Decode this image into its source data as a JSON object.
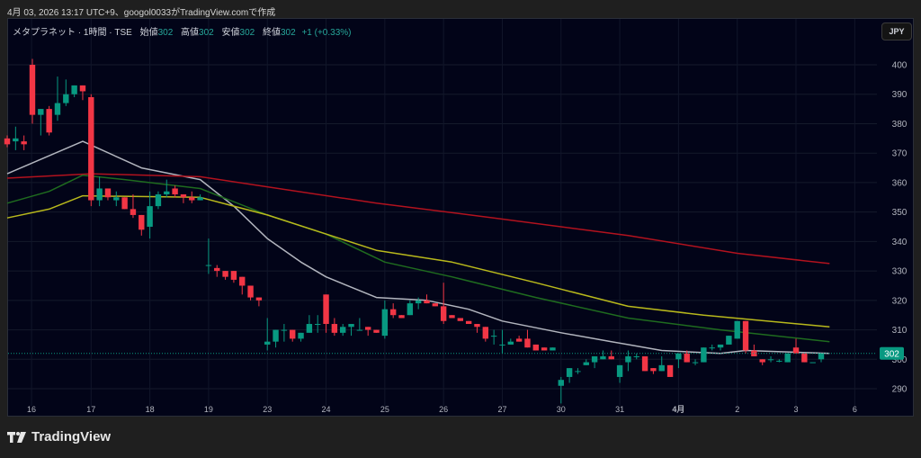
{
  "caption": "4月 03, 2026 13:17 UTC+9、googol0033がTradingView.comで作成",
  "legend": {
    "symbol": "メタプラネット · 1時間 · TSE",
    "open_label": "始値",
    "open": "302",
    "high_label": "高値",
    "high": "302",
    "low_label": "安値",
    "low": "302",
    "close_label": "終値",
    "close": "302",
    "change": "+1 (+0.33%)"
  },
  "currency_button": "JPY",
  "last_price_label": "302",
  "footer_brand": "TradingView",
  "colors": {
    "up": "#089981",
    "down": "#f23645",
    "ma_white": "#b2b5be",
    "ma_red": "#b2121e",
    "ma_green": "#1b5e20",
    "ma_yellow": "#b5b51a",
    "last": "#089981"
  },
  "chart_data": {
    "type": "candlestick",
    "ylim": [
      285,
      410
    ],
    "y_ticks": [
      290,
      300,
      310,
      320,
      330,
      340,
      350,
      360,
      370,
      380,
      390,
      400
    ],
    "x_ticks": [
      {
        "label": "16",
        "index": 2.9
      },
      {
        "label": "17",
        "index": 10
      },
      {
        "label": "18",
        "index": 17
      },
      {
        "label": "19",
        "index": 24
      },
      {
        "label": "23",
        "index": 31
      },
      {
        "label": "24",
        "index": 38
      },
      {
        "label": "25",
        "index": 45
      },
      {
        "label": "26",
        "index": 52
      },
      {
        "label": "27",
        "index": 59
      },
      {
        "label": "30",
        "index": 66
      },
      {
        "label": "31",
        "index": 73
      },
      {
        "label": "4月",
        "index": 80,
        "bold": true
      },
      {
        "label": "2",
        "index": 87
      },
      {
        "label": "3",
        "index": 94
      },
      {
        "label": "6",
        "index": 101
      }
    ],
    "last_price": 302,
    "ohlc": [
      [
        375,
        376,
        372,
        373
      ],
      [
        374,
        379,
        371,
        375
      ],
      [
        374,
        376,
        371,
        373
      ],
      [
        400,
        402,
        380,
        383
      ],
      [
        383,
        385,
        376,
        385
      ],
      [
        385,
        386,
        376,
        377
      ],
      [
        383,
        396,
        381,
        387
      ],
      [
        387,
        395,
        386,
        390
      ],
      [
        390,
        393,
        389,
        393
      ],
      [
        393,
        393,
        388,
        391
      ],
      [
        389,
        390,
        352,
        354
      ],
      [
        354,
        362,
        352,
        358
      ],
      [
        358,
        358,
        354,
        355
      ],
      [
        354,
        357,
        352,
        355
      ],
      [
        355,
        355,
        351,
        351
      ],
      [
        351,
        356,
        348,
        349
      ],
      [
        349,
        349,
        342,
        344
      ],
      [
        345,
        357,
        341,
        352
      ],
      [
        352,
        357,
        351,
        356
      ],
      [
        356,
        361,
        355,
        357
      ],
      [
        358,
        359,
        355,
        356
      ],
      [
        356,
        356,
        353,
        355
      ],
      [
        355,
        357,
        353,
        354
      ],
      [
        354,
        356,
        354,
        355
      ],
      [
        332,
        341,
        329,
        332
      ],
      [
        331,
        332,
        328,
        330
      ],
      [
        330,
        330,
        327,
        328
      ],
      [
        330,
        330,
        326,
        327
      ],
      [
        328,
        328,
        322,
        325
      ],
      [
        325,
        325,
        320,
        321
      ],
      [
        321,
        321,
        318,
        320
      ],
      [
        305,
        314,
        303,
        306
      ],
      [
        306,
        310,
        304,
        310
      ],
      [
        310,
        312,
        306,
        310
      ],
      [
        310,
        310,
        306,
        307
      ],
      [
        307,
        309,
        306,
        309
      ],
      [
        309,
        315,
        309,
        312
      ],
      [
        312,
        315,
        309,
        312
      ],
      [
        322,
        322,
        309,
        312
      ],
      [
        312,
        314,
        308,
        309
      ],
      [
        309,
        312,
        308,
        311
      ],
      [
        311,
        312,
        308,
        312
      ],
      [
        310,
        314,
        310,
        310
      ],
      [
        311,
        311,
        308,
        310
      ],
      [
        310,
        310,
        309,
        309
      ],
      [
        308,
        320,
        307,
        317
      ],
      [
        317,
        319,
        314,
        315
      ],
      [
        315,
        315,
        314,
        314
      ],
      [
        315,
        320,
        315,
        319
      ],
      [
        319,
        321,
        317,
        320
      ],
      [
        320,
        322,
        319,
        319
      ],
      [
        319,
        319,
        318,
        318
      ],
      [
        318,
        326,
        312,
        313
      ],
      [
        315,
        315,
        314,
        314
      ],
      [
        314,
        314,
        313,
        313
      ],
      [
        313,
        313,
        312,
        312
      ],
      [
        312,
        312,
        309,
        311
      ],
      [
        311,
        311,
        306,
        307
      ],
      [
        308,
        310,
        305,
        308
      ],
      [
        305,
        310,
        302,
        305
      ],
      [
        305,
        307,
        305,
        306
      ],
      [
        307,
        308,
        306,
        306
      ],
      [
        307,
        310,
        304,
        304
      ],
      [
        305,
        305,
        303,
        303
      ],
      [
        304,
        304,
        303,
        303
      ],
      [
        303,
        304,
        303,
        304
      ],
      [
        291,
        294,
        285,
        293
      ],
      [
        294,
        297,
        292,
        297
      ],
      [
        296,
        297,
        295,
        296
      ],
      [
        298,
        300,
        298,
        299
      ],
      [
        299,
        301,
        297,
        301
      ],
      [
        300,
        303,
        300,
        301
      ],
      [
        301,
        303,
        300,
        300
      ],
      [
        294,
        298,
        292,
        298
      ],
      [
        299,
        303,
        296,
        301
      ],
      [
        301,
        302,
        300,
        301
      ],
      [
        301,
        301,
        296,
        296
      ],
      [
        297,
        297,
        295,
        296
      ],
      [
        296,
        301,
        296,
        298
      ],
      [
        298,
        298,
        294,
        294
      ],
      [
        300,
        302,
        297,
        302
      ],
      [
        302,
        303,
        299,
        299
      ],
      [
        299,
        300,
        298,
        299
      ],
      [
        299,
        304,
        299,
        304
      ],
      [
        304,
        305,
        303,
        304
      ],
      [
        304,
        305,
        303,
        305
      ],
      [
        305,
        308,
        305,
        308
      ],
      [
        307,
        313,
        307,
        313
      ],
      [
        313,
        313,
        302,
        303
      ],
      [
        303,
        305,
        302,
        301
      ],
      [
        300,
        300,
        298,
        299
      ],
      [
        300,
        301,
        299,
        300
      ],
      [
        299.5,
        300,
        299,
        299.5
      ],
      [
        299,
        302,
        299,
        302
      ],
      [
        304,
        307,
        302,
        302
      ],
      [
        302,
        302,
        299,
        299
      ],
      [
        299,
        299,
        299,
        299
      ],
      [
        300,
        302,
        299,
        302
      ]
    ],
    "moving_averages": [
      {
        "name": "ma-white",
        "color": "#b2b5be",
        "points": [
          [
            0,
            363
          ],
          [
            9,
            374
          ],
          [
            16,
            365
          ],
          [
            23,
            361
          ],
          [
            27,
            352
          ],
          [
            31,
            341
          ],
          [
            35,
            333
          ],
          [
            38,
            328
          ],
          [
            44,
            321
          ],
          [
            50,
            320
          ],
          [
            55,
            317
          ],
          [
            59,
            313
          ],
          [
            66,
            309
          ],
          [
            72,
            306
          ],
          [
            78,
            303
          ],
          [
            85,
            302
          ],
          [
            88,
            303
          ],
          [
            98,
            302
          ]
        ]
      },
      {
        "name": "ma-red",
        "color": "#b2121e",
        "points": [
          [
            0,
            361.5
          ],
          [
            10,
            363
          ],
          [
            23,
            362
          ],
          [
            30,
            359
          ],
          [
            44,
            353
          ],
          [
            58,
            348
          ],
          [
            74,
            342
          ],
          [
            87,
            336
          ],
          [
            98,
            332.5
          ]
        ]
      },
      {
        "name": "ma-green",
        "color": "#1f6b1f",
        "points": [
          [
            0,
            353
          ],
          [
            5,
            357
          ],
          [
            9,
            362.5
          ],
          [
            14,
            361
          ],
          [
            23,
            358
          ],
          [
            31,
            349
          ],
          [
            38,
            342.5
          ],
          [
            45,
            333
          ],
          [
            53,
            328
          ],
          [
            63,
            321
          ],
          [
            74,
            314
          ],
          [
            85,
            310
          ],
          [
            98,
            306
          ]
        ]
      },
      {
        "name": "ma-yellow",
        "color": "#b8b81c",
        "points": [
          [
            0,
            348
          ],
          [
            5,
            351
          ],
          [
            9,
            355.5
          ],
          [
            23,
            355
          ],
          [
            31,
            349
          ],
          [
            44,
            337
          ],
          [
            53,
            333
          ],
          [
            63,
            326
          ],
          [
            74,
            318
          ],
          [
            83,
            315
          ],
          [
            98,
            311
          ]
        ]
      }
    ]
  }
}
